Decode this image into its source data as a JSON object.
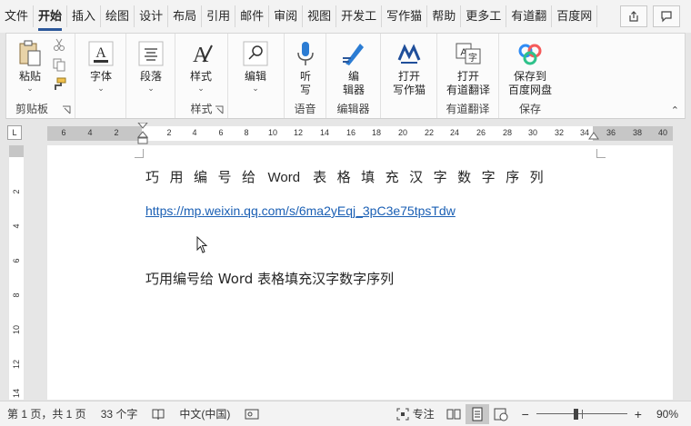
{
  "tabs": [
    "文件",
    "开始",
    "插入",
    "绘图",
    "设计",
    "布局",
    "引用",
    "邮件",
    "审阅",
    "视图",
    "开发工",
    "写作猫",
    "帮助",
    "更多工",
    "有道翻",
    "百度网"
  ],
  "active_tab": "开始",
  "ribbon": {
    "clipboard": {
      "paste": "粘贴",
      "group": "剪贴板"
    },
    "font": {
      "label": "字体"
    },
    "paragraph": {
      "label": "段落"
    },
    "styles": {
      "label": "样式",
      "group": "样式"
    },
    "editing": {
      "label": "编辑"
    },
    "voice": {
      "label1": "听",
      "label2": "写",
      "group": "语音"
    },
    "editor": {
      "label1": "编",
      "label2": "辑器",
      "group": "编辑器"
    },
    "xiezuomao": {
      "label1": "打开",
      "label2": "写作猫"
    },
    "youdao": {
      "label1": "打开",
      "label2": "有道翻译",
      "group": "有道翻译"
    },
    "baidu": {
      "label1": "保存到",
      "label2": "百度网盘",
      "group": "保存"
    }
  },
  "ruler": {
    "corner": "L",
    "left_ticks": [
      "6",
      "4",
      "2"
    ],
    "right_ticks": [
      "2",
      "4",
      "6",
      "8",
      "10",
      "12",
      "14",
      "16",
      "18",
      "20",
      "22",
      "24",
      "26",
      "28",
      "30",
      "32",
      "34",
      "36",
      "38",
      "40"
    ],
    "vertical_ticks": [
      "2",
      "4",
      "6",
      "8",
      "10",
      "12",
      "14"
    ]
  },
  "document": {
    "title_part1": "巧用编号给",
    "title_latin": "Word",
    "title_part2": "表格填充汉字数字序列",
    "link": "https://mp.weixin.qq.com/s/6ma2yEqj_3pC3e75tpsTdw",
    "title_plain": "巧用编号给 Word 表格填充汉字数字序列"
  },
  "status": {
    "page": "第 1 页，共 1 页",
    "words": "33 个字",
    "language": "中文(中国)",
    "focus": "专注",
    "zoom": "90%",
    "zoom_minus": "−",
    "zoom_plus": "+",
    "zoom_fraction": 0.43
  },
  "colors": {
    "accent": "#2b579a",
    "link": "#1a5fb4"
  }
}
